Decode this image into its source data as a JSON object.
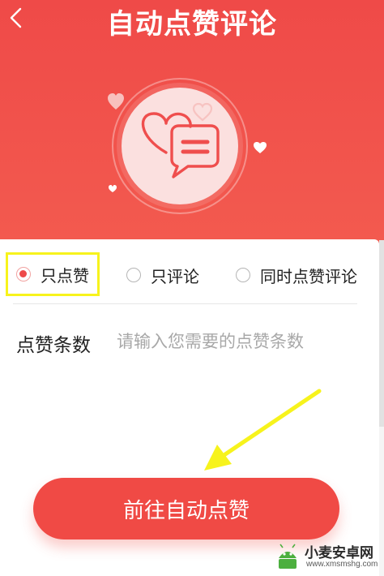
{
  "header": {
    "title": "自动点赞评论",
    "back_icon": "chevron-left-icon",
    "hero_icon": "chat-bubbles-heart-icon"
  },
  "mode_options": [
    {
      "label": "只点赞",
      "selected": true
    },
    {
      "label": "只评论",
      "selected": false
    },
    {
      "label": "同时点赞评论",
      "selected": false
    }
  ],
  "like_count": {
    "label": "点赞条数",
    "placeholder": "请输入您需要的点赞条数",
    "value": ""
  },
  "submit": {
    "label": "前往自动点赞"
  },
  "watermark": {
    "title": "小麦安卓网",
    "url": "www.xmsmshg.com"
  },
  "colors": {
    "primary": "#ef4a48",
    "highlight": "#f7f31c",
    "white": "#ffffff"
  }
}
